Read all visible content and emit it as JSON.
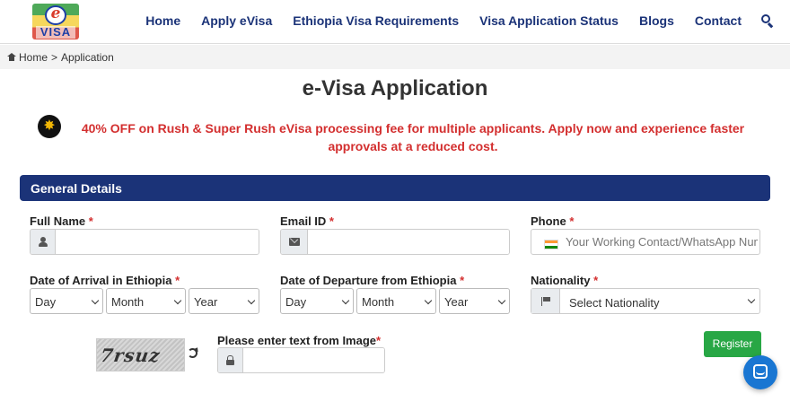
{
  "header": {
    "logo_top": "e",
    "logo_bottom": "VISA",
    "nav": [
      "Home",
      "Apply eVisa",
      "Ethiopia Visa Requirements",
      "Visa Application Status",
      "Blogs",
      "Contact"
    ]
  },
  "breadcrumb": {
    "home": "Home",
    "separator": ">",
    "current": "Application"
  },
  "page_title": "e-Visa Application",
  "promo_text": "40% OFF on Rush & Super Rush eVisa processing fee for multiple applicants. Apply now and experience faster approvals at a reduced cost.",
  "section_title": "General Details",
  "form": {
    "full_name_label": "Full Name",
    "email_label": "Email ID",
    "phone_label": "Phone",
    "phone_placeholder": "Your Working Contact/WhatsApp Number",
    "arrival_label": "Date of Arrival in Ethiopia",
    "departure_label": "Date of Departure from Ethiopia",
    "nationality_label": "Nationality",
    "nationality_value": "Select Nationality",
    "day": "Day",
    "month": "Month",
    "year": "Year",
    "required_mark": "*",
    "captcha_label": "Please enter text from Image",
    "captcha_text": "7rsuz",
    "register_label": "Register"
  },
  "colors": {
    "nav": "#1b3378",
    "promo": "#d32f2f",
    "section_bar": "#1b3378",
    "register": "#28a745",
    "chat": "#1976d2"
  }
}
